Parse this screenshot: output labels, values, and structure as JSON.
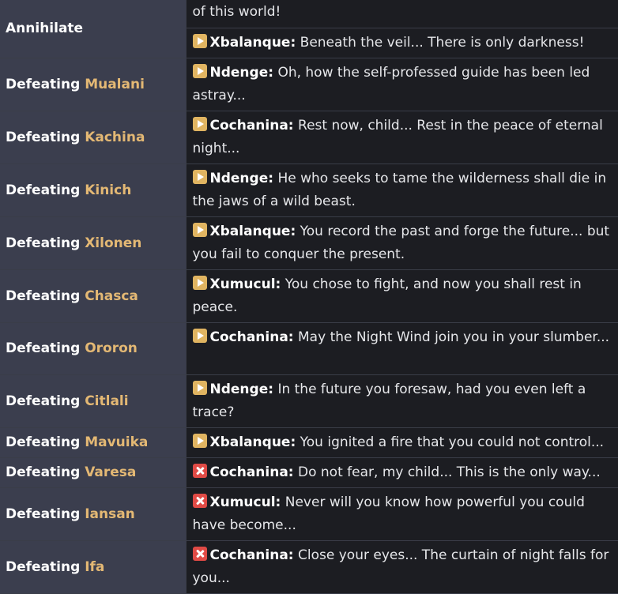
{
  "rows": [
    {
      "prefix": "Annihilate",
      "name": "",
      "icon": "",
      "speaker": "",
      "text": "of this world!"
    },
    {
      "prefix": "",
      "name": "",
      "icon": "play-icon",
      "speaker": "Xbalanque:",
      "text": "Beneath the veil... There is only darkness!"
    },
    {
      "prefix": "Defeating",
      "name": "Mualani",
      "icon": "play-icon",
      "speaker": "Ndenge:",
      "text": "Oh, how the self-professed guide has been led astray..."
    },
    {
      "prefix": "Defeating",
      "name": "Kachina",
      "icon": "play-icon",
      "speaker": "Cochanina:",
      "text": "Rest now, child... Rest in the peace of eternal night..."
    },
    {
      "prefix": "Defeating",
      "name": "Kinich",
      "icon": "play-icon",
      "speaker": "Ndenge:",
      "text": "He who seeks to tame the wilderness shall die in the jaws of a wild beast."
    },
    {
      "prefix": "Defeating",
      "name": "Xilonen",
      "icon": "play-icon",
      "speaker": "Xbalanque:",
      "text": "You record the past and forge the future... but you fail to conquer the present."
    },
    {
      "prefix": "Defeating",
      "name": "Chasca",
      "icon": "play-icon",
      "speaker": "Xumucul:",
      "text": "You chose to fight, and now you shall rest in peace."
    },
    {
      "prefix": "Defeating",
      "name": "Ororon",
      "icon": "play-icon",
      "speaker": "Cochanina:",
      "text": "May the Night Wind join you in your slumber..."
    },
    {
      "prefix": "Defeating",
      "name": "Citlali",
      "icon": "play-icon",
      "speaker": "Ndenge:",
      "text": "In the future you foresaw, had you even left a trace?"
    },
    {
      "prefix": "Defeating",
      "name": "Mavuika",
      "icon": "play-icon",
      "speaker": "Xbalanque:",
      "text": "You ignited a fire that you could not control..."
    },
    {
      "prefix": "Defeating",
      "name": "Varesa",
      "icon": "close-icon",
      "speaker": "Cochanina:",
      "text": "Do not fear, my child... This is the only way..."
    },
    {
      "prefix": "Defeating",
      "name": "Iansan",
      "icon": "close-icon",
      "speaker": "Xumucul:",
      "text": "Never will you know how powerful you could have become..."
    },
    {
      "prefix": "Defeating",
      "name": "Ifa",
      "icon": "close-icon",
      "speaker": "Cochanina:",
      "text": "Close your eyes... The curtain of night falls for you..."
    }
  ]
}
